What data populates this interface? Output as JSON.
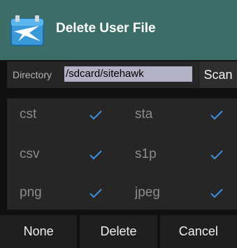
{
  "dialog": {
    "title": "Delete User File",
    "app_icon": "sitehawk-bird-icon"
  },
  "directory": {
    "label": "Directory",
    "value": "/sdcard/sitehawk",
    "scan_label": "Scan"
  },
  "file_types": [
    {
      "label": "cst",
      "checked": true
    },
    {
      "label": "sta",
      "checked": true
    },
    {
      "label": "csv",
      "checked": true
    },
    {
      "label": "s1p",
      "checked": true
    },
    {
      "label": "png",
      "checked": true
    },
    {
      "label": "jpeg",
      "checked": true
    }
  ],
  "buttons": {
    "none": "None",
    "delete": "Delete",
    "cancel": "Cancel"
  },
  "colors": {
    "titlebar": "#3c6d66",
    "check": "#3d8fe0",
    "input_bg": "#b3b1c6"
  }
}
